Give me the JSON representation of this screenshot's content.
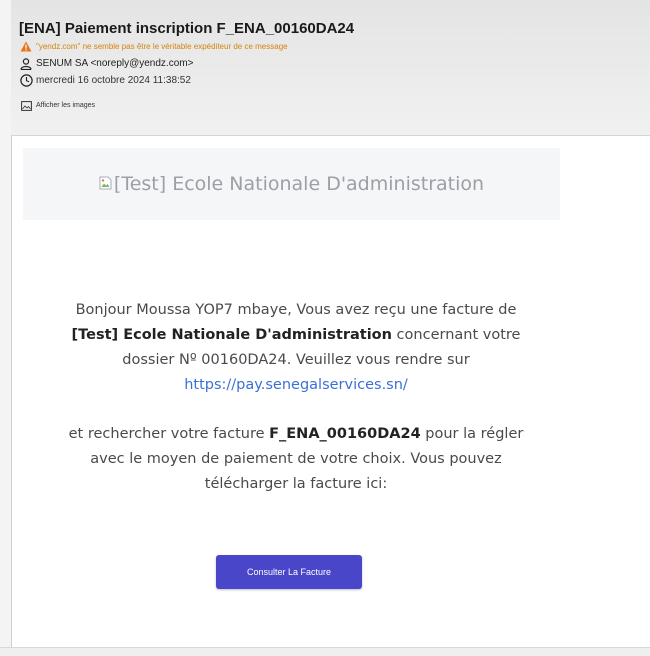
{
  "header": {
    "subject": "[ENA] Paiement inscription F_ENA_00160DA24",
    "warning": "\"yendz.com\" ne semble pas être le véritable expéditeur de ce message",
    "sender": "SENUM SA <noreply@yendz.com>",
    "date": "mercredi 16 octobre 2024 11:38:52",
    "show_images": "Afficher les images"
  },
  "banner": {
    "alt_text": "[Test] Ecole Nationale D'administration"
  },
  "message": {
    "p1_text1": "Bonjour Moussa YOP7 mbaye, Vous avez reçu une facture de ",
    "p1_bold": "[Test] Ecole Nationale D'administration",
    "p1_text2": " concernant votre dossier Nº 00160DA24. Veuillez vous rendre sur ",
    "p1_link": "https://pay.senegalservices.sn/",
    "p2_text1": "et rechercher votre facture ",
    "p2_bold": "F_ENA_00160DA24",
    "p2_text2": " pour la régler avec le moyen de paiement de votre choix. Vous pouvez télécharger la facture ici:"
  },
  "button": {
    "label": "Consulter La Facture"
  },
  "colors": {
    "warning": "#d4830e",
    "link": "#3b6fd8",
    "button": "#4a46c9"
  },
  "icons": [
    "warning-icon",
    "person-icon",
    "clock-icon",
    "image-icon",
    "broken-image-icon"
  ]
}
